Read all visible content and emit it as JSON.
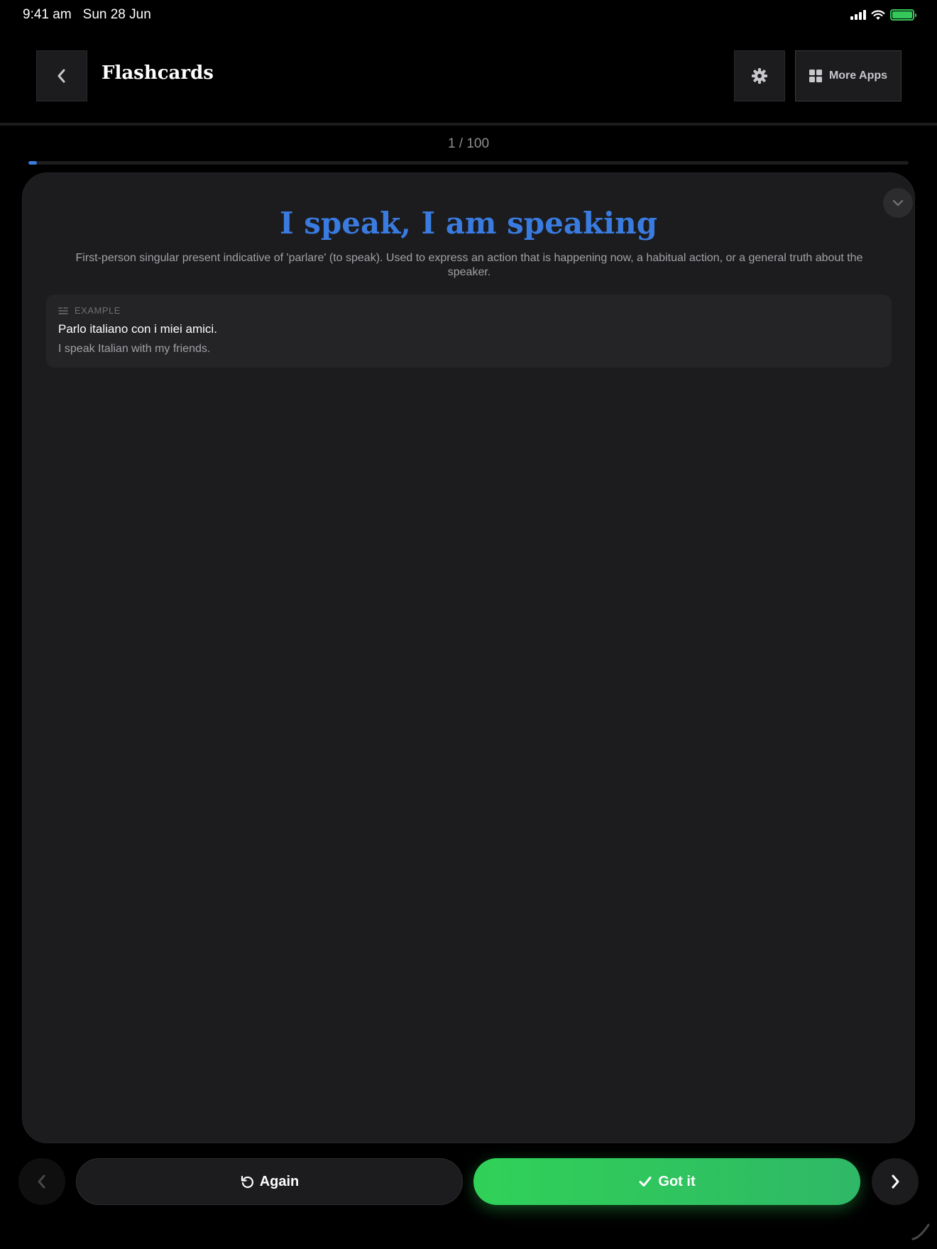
{
  "status_bar": {
    "time": "9:41 am",
    "date": "Sun 28 Jun",
    "icons": [
      "cellular-signal-icon",
      "wifi-icon",
      "battery-charging-icon"
    ]
  },
  "header": {
    "back_icon": "chevron-left-icon",
    "title": "Flashcards",
    "settings_icon": "gear-icon",
    "more_apps_icon": "grid-icon",
    "more_apps_label": "More Apps"
  },
  "progress": {
    "counter": "1 / 100",
    "current": 1,
    "total": 100,
    "fraction": 0.01
  },
  "card": {
    "collapse_icon": "chevron-down-icon",
    "term": "I speak, I am speaking",
    "description": "First-person singular present indicative of 'parlare' (to speak). Used to express an action that is happening now, a habitual action, or a general truth about the speaker.",
    "example": {
      "icon": "text-lines-icon",
      "label": "EXAMPLE",
      "sentence": "Parlo italiano con i miei amici.",
      "translation": "I speak Italian with my friends."
    }
  },
  "actions": {
    "prev_icon": "chevron-left-icon",
    "again_icon": "rotate-ccw-icon",
    "again_label": "Again",
    "got_it_icon": "checkmark-icon",
    "got_it_label": "Got it",
    "next_icon": "chevron-right-icon"
  },
  "colors": {
    "accent_blue": "#3a7be0",
    "success_green": "#30d158",
    "background": "#000000",
    "card_bg": "#1c1c1e"
  }
}
